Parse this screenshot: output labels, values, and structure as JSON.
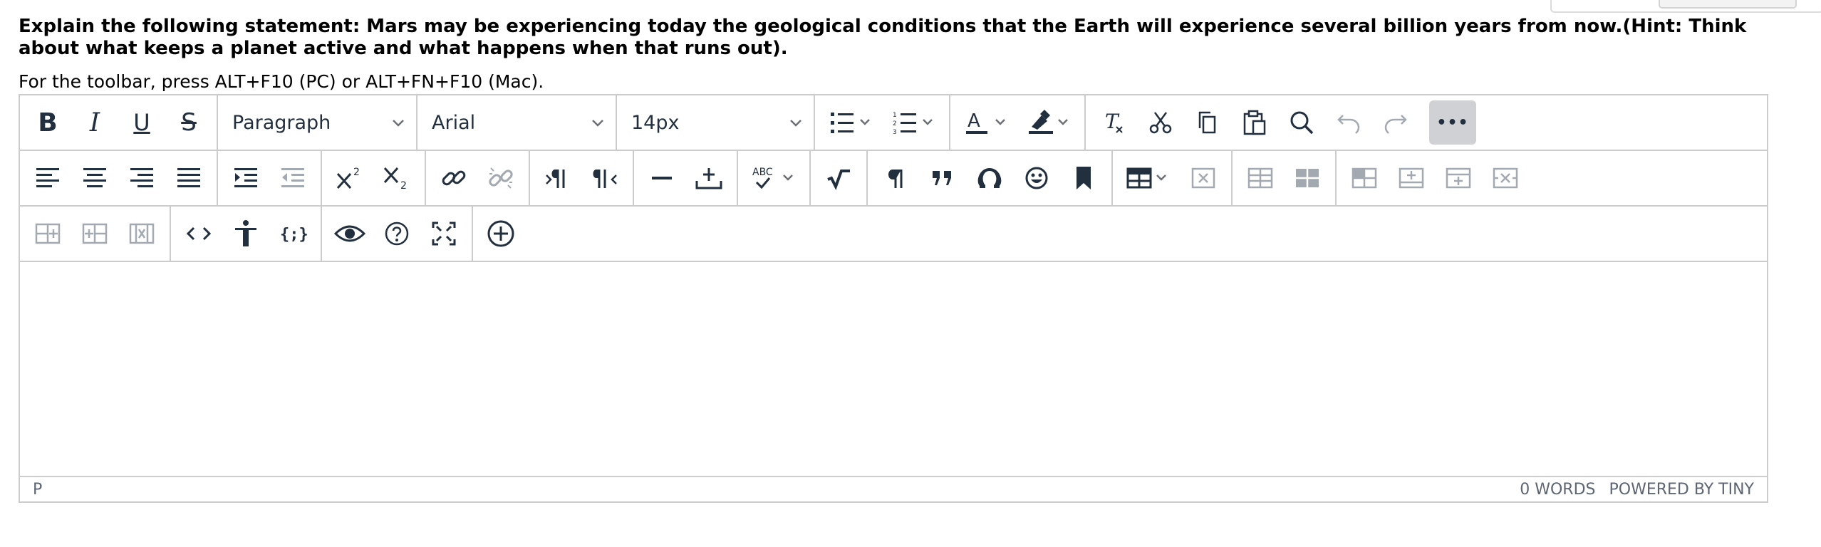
{
  "question": {
    "text": "Explain the following statement: Mars may be experiencing today the geological conditions that the Earth will experience several billion years from now.(Hint: Think about what keeps a planet active and what happens when that runs out)."
  },
  "toolbar_hint": "For the toolbar, press ALT+F10 (PC) or ALT+FN+F10 (Mac).",
  "toolbar": {
    "bold_label": "B",
    "italic_label": "I",
    "underline_label": "U",
    "strike_label": "S",
    "block_format": "Paragraph",
    "font_family": "Arial",
    "font_size": "14px",
    "more_label": "•••"
  },
  "status": {
    "path": "P",
    "words": "0 WORDS",
    "powered": "POWERED BY TINY"
  },
  "colors": {
    "border": "#cccccc",
    "icon": "#222f3e",
    "icon_disabled": "#a3a9b0",
    "active_bg": "#cfd1d4"
  }
}
